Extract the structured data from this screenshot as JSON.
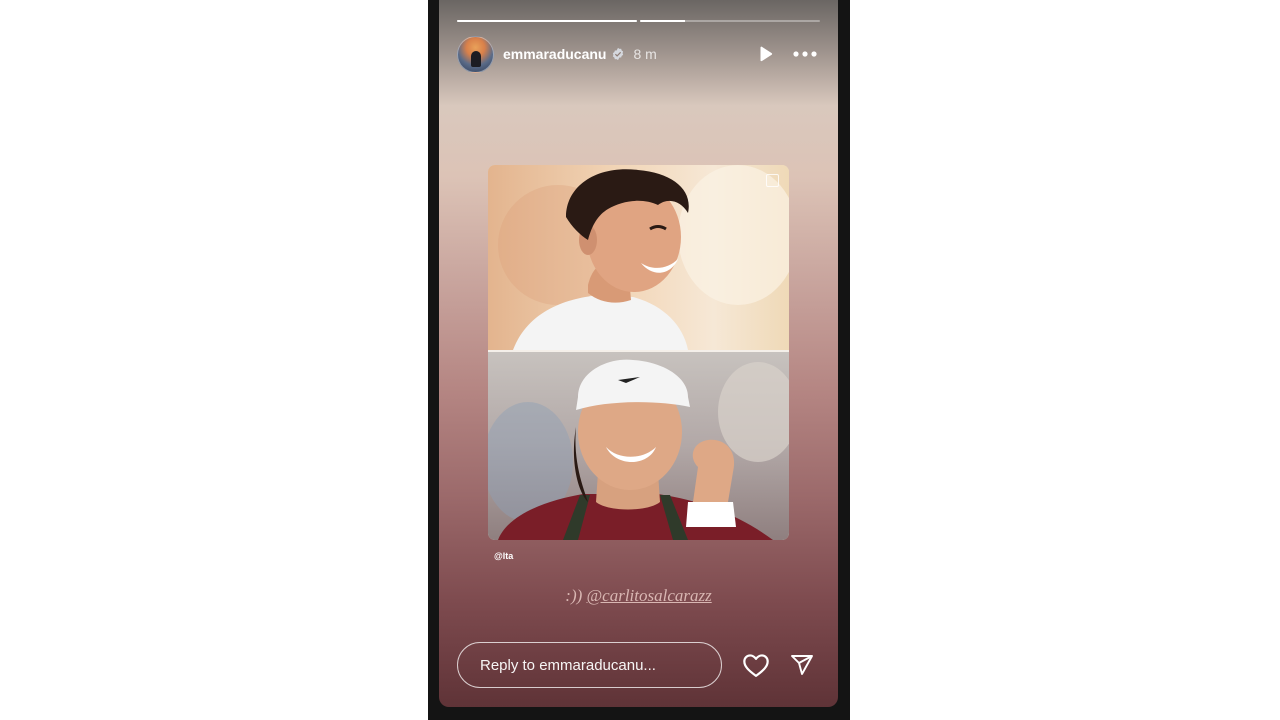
{
  "story": {
    "progress": [
      1.0,
      0.25
    ],
    "user": {
      "username": "emmaraducanu",
      "time": "8 m"
    },
    "credit": "@lta",
    "caption": {
      "prefix": ":))",
      "mention": "@carlitosalcarazz"
    },
    "reply": {
      "placeholder": "Reply to emmaraducanu..."
    },
    "icons": {
      "verified": "verified-badge-icon",
      "play": "play-icon",
      "more": "more-icon",
      "like": "heart-icon",
      "share": "send-icon"
    }
  }
}
